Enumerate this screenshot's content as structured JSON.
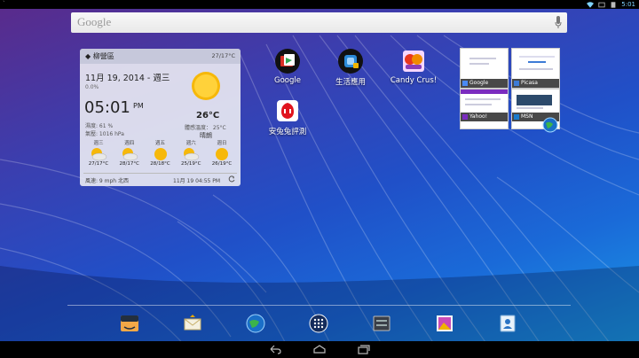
{
  "status_bar": {
    "left_indicator": "`",
    "time": "5:01",
    "icons": [
      "wifi-icon",
      "screenshot-icon",
      "battery-icon"
    ]
  },
  "search": {
    "logo": "Google",
    "icon": "mic-icon"
  },
  "weather": {
    "location": "柳營區",
    "temp_range": "27/17°C",
    "date": "11月 19, 2014 - 週三",
    "rain": "0.0%",
    "time": "05:01",
    "ampm": "PM",
    "humidity": "濕度: 61 %",
    "pressure": "氣壓: 1016 hPa",
    "current_temp": "26°C",
    "feels_like": "體感溫度： 25°C",
    "condition": "晴朗",
    "forecast": [
      {
        "day": "週三",
        "range": "27/17°C",
        "icon": "cloudy-sun-icon"
      },
      {
        "day": "週四",
        "range": "28/17°C",
        "icon": "cloudy-sun-icon"
      },
      {
        "day": "週五",
        "range": "28/18°C",
        "icon": "sun-icon"
      },
      {
        "day": "週六",
        "range": "25/19°C",
        "icon": "cloudy-sun-icon"
      },
      {
        "day": "週日",
        "range": "26/19°C",
        "icon": "sun-icon"
      }
    ],
    "wind": "風速: 9 mph 北西",
    "updated": "11月 19  04:55 PM"
  },
  "apps": [
    {
      "label": "Google",
      "icon": "google-folder-icon"
    },
    {
      "label": "生活應用",
      "icon": "life-apps-folder-icon"
    },
    {
      "label": "Candy Crus!",
      "icon": "candy-crush-icon"
    },
    {
      "label": "安兔兔評測",
      "icon": "antutu-icon"
    }
  ],
  "bookmarks": [
    {
      "title": "Google",
      "accent": "#4a8af4"
    },
    {
      "title": "Picasa",
      "accent": "#3d7bd6"
    },
    {
      "title": "Yahoo!",
      "accent": "#7b2cbf"
    },
    {
      "title": "MSN",
      "accent": "#1a7acb"
    }
  ],
  "dock": [
    "amazon-icon",
    "email-icon",
    "browser-globe-icon",
    "all-apps-icon",
    "settings-icon",
    "gallery-icon",
    "contacts-icon"
  ],
  "nav": [
    "back-icon",
    "home-icon",
    "recents-icon"
  ]
}
